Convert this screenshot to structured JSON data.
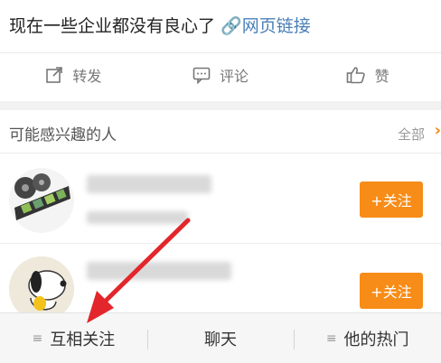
{
  "post": {
    "text": "现在一些企业都没有良心了",
    "link_label": "网页链接"
  },
  "actions": [
    {
      "label": "转发",
      "icon": "share-icon"
    },
    {
      "label": "评论",
      "icon": "comment-icon"
    },
    {
      "label": "赞",
      "icon": "like-icon"
    }
  ],
  "recommendations": {
    "title": "可能感兴趣的人",
    "all_label": "全部",
    "follow_label": "+关注"
  },
  "tabs": [
    {
      "label": "互相关注",
      "icon": "menu-icon"
    },
    {
      "label": "聊天"
    },
    {
      "label": "他的热门",
      "icon": "menu-icon"
    }
  ],
  "colors": {
    "accent_orange": "#f78c18",
    "link_blue": "#4a7fb8",
    "annotation_red": "#e3262b"
  }
}
